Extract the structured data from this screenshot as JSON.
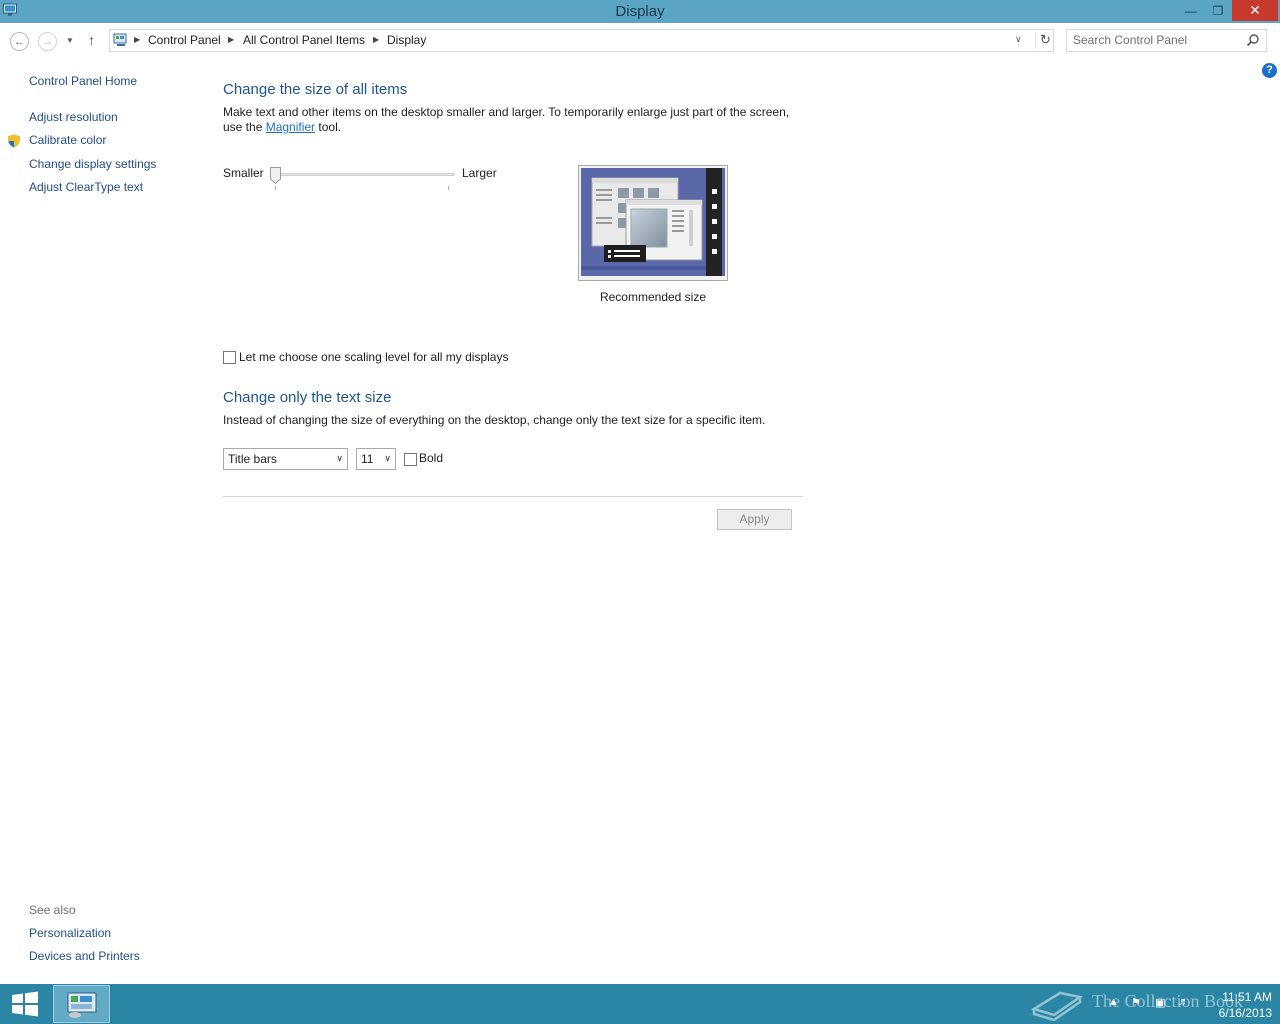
{
  "window": {
    "title": "Display"
  },
  "address": {
    "crumbs": [
      "Control Panel",
      "All Control Panel Items",
      "Display"
    ],
    "search_placeholder": "Search Control Panel"
  },
  "sidebar": {
    "home": "Control Panel Home",
    "items": [
      "Adjust resolution",
      "Calibrate color",
      "Change display settings",
      "Adjust ClearType text"
    ],
    "see_also_label": "See also",
    "see_also": [
      "Personalization",
      "Devices and Printers"
    ]
  },
  "main": {
    "size_heading": "Change the size of all items",
    "size_desc_1": "Make text and other items on the desktop smaller and larger. To temporarily enlarge just part of the screen,",
    "size_desc_2_pre": "use the ",
    "size_desc_link": "Magnifier",
    "size_desc_2_post": " tool.",
    "slider_min_label": "Smaller",
    "slider_max_label": "Larger",
    "slider_value": 0,
    "preview_caption": "Recommended size",
    "scaling_checkbox_label": "Let me choose one scaling level for all my displays",
    "scaling_checked": false,
    "text_heading": "Change only the text size",
    "text_desc": "Instead of changing the size of everything on the desktop, change only the text size for a specific item.",
    "item_select": "Title bars",
    "size_select": "11",
    "bold_label": "Bold",
    "bold_checked": false,
    "apply_label": "Apply"
  },
  "taskbar": {
    "watermark": "The Collection Book",
    "time": "11:51 AM",
    "date": "6/16/2013"
  },
  "colors": {
    "titlebar": "#5aa4c4",
    "close": "#c7392c",
    "link": "#1f4d8c",
    "heading": "#1e5591",
    "taskbar": "#2b86a6"
  }
}
